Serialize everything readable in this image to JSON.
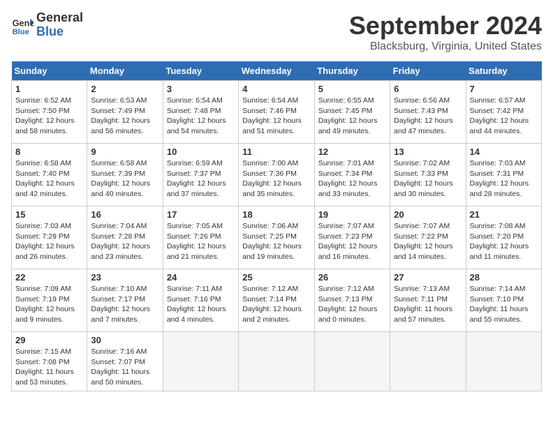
{
  "header": {
    "logo_line1": "General",
    "logo_line2": "Blue",
    "month": "September 2024",
    "location": "Blacksburg, Virginia, United States"
  },
  "weekdays": [
    "Sunday",
    "Monday",
    "Tuesday",
    "Wednesday",
    "Thursday",
    "Friday",
    "Saturday"
  ],
  "weeks": [
    [
      {
        "day": "1",
        "info": "Sunrise: 6:52 AM\nSunset: 7:50 PM\nDaylight: 12 hours\nand 58 minutes."
      },
      {
        "day": "2",
        "info": "Sunrise: 6:53 AM\nSunset: 7:49 PM\nDaylight: 12 hours\nand 56 minutes."
      },
      {
        "day": "3",
        "info": "Sunrise: 6:54 AM\nSunset: 7:48 PM\nDaylight: 12 hours\nand 54 minutes."
      },
      {
        "day": "4",
        "info": "Sunrise: 6:54 AM\nSunset: 7:46 PM\nDaylight: 12 hours\nand 51 minutes."
      },
      {
        "day": "5",
        "info": "Sunrise: 6:55 AM\nSunset: 7:45 PM\nDaylight: 12 hours\nand 49 minutes."
      },
      {
        "day": "6",
        "info": "Sunrise: 6:56 AM\nSunset: 7:43 PM\nDaylight: 12 hours\nand 47 minutes."
      },
      {
        "day": "7",
        "info": "Sunrise: 6:57 AM\nSunset: 7:42 PM\nDaylight: 12 hours\nand 44 minutes."
      }
    ],
    [
      {
        "day": "8",
        "info": "Sunrise: 6:58 AM\nSunset: 7:40 PM\nDaylight: 12 hours\nand 42 minutes."
      },
      {
        "day": "9",
        "info": "Sunrise: 6:58 AM\nSunset: 7:39 PM\nDaylight: 12 hours\nand 40 minutes."
      },
      {
        "day": "10",
        "info": "Sunrise: 6:59 AM\nSunset: 7:37 PM\nDaylight: 12 hours\nand 37 minutes."
      },
      {
        "day": "11",
        "info": "Sunrise: 7:00 AM\nSunset: 7:36 PM\nDaylight: 12 hours\nand 35 minutes."
      },
      {
        "day": "12",
        "info": "Sunrise: 7:01 AM\nSunset: 7:34 PM\nDaylight: 12 hours\nand 33 minutes."
      },
      {
        "day": "13",
        "info": "Sunrise: 7:02 AM\nSunset: 7:33 PM\nDaylight: 12 hours\nand 30 minutes."
      },
      {
        "day": "14",
        "info": "Sunrise: 7:03 AM\nSunset: 7:31 PM\nDaylight: 12 hours\nand 28 minutes."
      }
    ],
    [
      {
        "day": "15",
        "info": "Sunrise: 7:03 AM\nSunset: 7:29 PM\nDaylight: 12 hours\nand 26 minutes."
      },
      {
        "day": "16",
        "info": "Sunrise: 7:04 AM\nSunset: 7:28 PM\nDaylight: 12 hours\nand 23 minutes."
      },
      {
        "day": "17",
        "info": "Sunrise: 7:05 AM\nSunset: 7:26 PM\nDaylight: 12 hours\nand 21 minutes."
      },
      {
        "day": "18",
        "info": "Sunrise: 7:06 AM\nSunset: 7:25 PM\nDaylight: 12 hours\nand 19 minutes."
      },
      {
        "day": "19",
        "info": "Sunrise: 7:07 AM\nSunset: 7:23 PM\nDaylight: 12 hours\nand 16 minutes."
      },
      {
        "day": "20",
        "info": "Sunrise: 7:07 AM\nSunset: 7:22 PM\nDaylight: 12 hours\nand 14 minutes."
      },
      {
        "day": "21",
        "info": "Sunrise: 7:08 AM\nSunset: 7:20 PM\nDaylight: 12 hours\nand 11 minutes."
      }
    ],
    [
      {
        "day": "22",
        "info": "Sunrise: 7:09 AM\nSunset: 7:19 PM\nDaylight: 12 hours\nand 9 minutes."
      },
      {
        "day": "23",
        "info": "Sunrise: 7:10 AM\nSunset: 7:17 PM\nDaylight: 12 hours\nand 7 minutes."
      },
      {
        "day": "24",
        "info": "Sunrise: 7:11 AM\nSunset: 7:16 PM\nDaylight: 12 hours\nand 4 minutes."
      },
      {
        "day": "25",
        "info": "Sunrise: 7:12 AM\nSunset: 7:14 PM\nDaylight: 12 hours\nand 2 minutes."
      },
      {
        "day": "26",
        "info": "Sunrise: 7:12 AM\nSunset: 7:13 PM\nDaylight: 12 hours\nand 0 minutes."
      },
      {
        "day": "27",
        "info": "Sunrise: 7:13 AM\nSunset: 7:11 PM\nDaylight: 11 hours\nand 57 minutes."
      },
      {
        "day": "28",
        "info": "Sunrise: 7:14 AM\nSunset: 7:10 PM\nDaylight: 11 hours\nand 55 minutes."
      }
    ],
    [
      {
        "day": "29",
        "info": "Sunrise: 7:15 AM\nSunset: 7:08 PM\nDaylight: 11 hours\nand 53 minutes."
      },
      {
        "day": "30",
        "info": "Sunrise: 7:16 AM\nSunset: 7:07 PM\nDaylight: 11 hours\nand 50 minutes."
      },
      {
        "day": "",
        "info": ""
      },
      {
        "day": "",
        "info": ""
      },
      {
        "day": "",
        "info": ""
      },
      {
        "day": "",
        "info": ""
      },
      {
        "day": "",
        "info": ""
      }
    ]
  ]
}
